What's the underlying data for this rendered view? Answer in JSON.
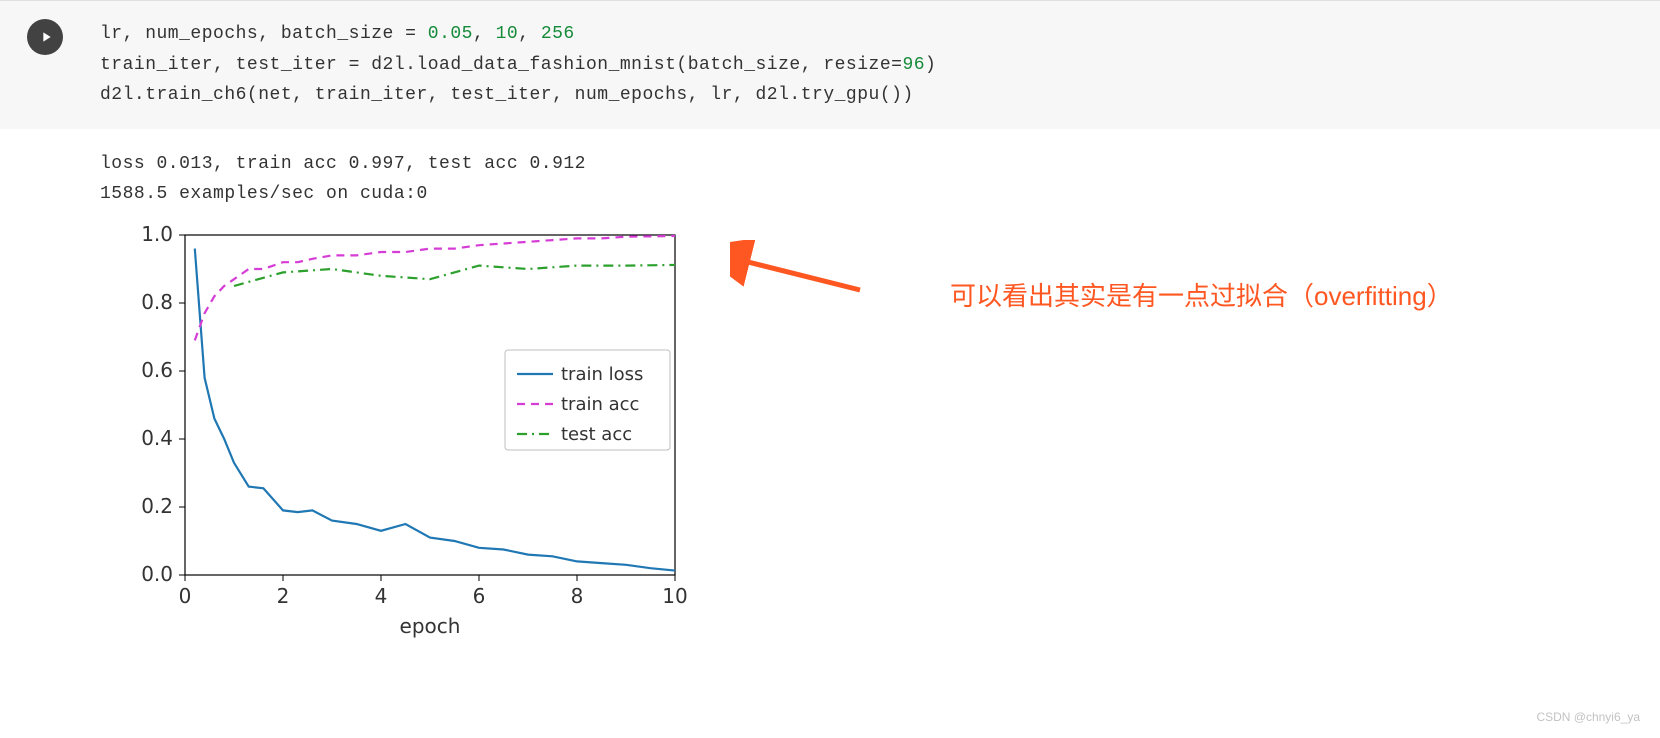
{
  "code": {
    "line1_part1": "lr, num_epochs, batch_size = ",
    "line1_num1": "0.05",
    "line1_sep1": ", ",
    "line1_num2": "10",
    "line1_sep2": ", ",
    "line1_num3": "256",
    "line2_part1": "train_iter, test_iter = d2l.load_data_fashion_mnist(batch_size, resize=",
    "line2_num1": "96",
    "line2_part2": ")",
    "line3": "d2l.train_ch6(net, train_iter, test_iter, num_epochs, lr, d2l.try_gpu())"
  },
  "output": {
    "line1": "loss 0.013, train acc 0.997, test acc 0.912",
    "line2": "1588.5 examples/sec on cuda:0"
  },
  "annotation": {
    "text": "可以看出其实是有一点过拟合（overfitting）"
  },
  "watermark": "CSDN @chnyi6_ya",
  "chart_data": {
    "type": "line",
    "xlabel": "epoch",
    "ylabel": "",
    "xlim": [
      0,
      10
    ],
    "ylim": [
      0.0,
      1.0
    ],
    "xticks": [
      0,
      2,
      4,
      6,
      8,
      10
    ],
    "yticks": [
      0.0,
      0.2,
      0.4,
      0.6,
      0.8,
      1.0
    ],
    "legend": {
      "entries": [
        "train loss",
        "train acc",
        "test acc"
      ],
      "position": "right-inside"
    },
    "series": [
      {
        "name": "train loss",
        "style": "solid",
        "color": "#1f77b4",
        "x": [
          0.2,
          0.4,
          0.6,
          0.8,
          1.0,
          1.3,
          1.6,
          2.0,
          2.3,
          2.6,
          3.0,
          3.5,
          4.0,
          4.5,
          5.0,
          5.5,
          6.0,
          6.5,
          7.0,
          7.5,
          8.0,
          8.5,
          9.0,
          9.5,
          10.0
        ],
        "y": [
          0.96,
          0.58,
          0.46,
          0.4,
          0.33,
          0.26,
          0.255,
          0.19,
          0.185,
          0.19,
          0.16,
          0.15,
          0.13,
          0.15,
          0.11,
          0.1,
          0.08,
          0.075,
          0.06,
          0.055,
          0.04,
          0.035,
          0.03,
          0.02,
          0.013
        ]
      },
      {
        "name": "train acc",
        "style": "dashed",
        "color": "#d63cd6",
        "x": [
          0.2,
          0.4,
          0.6,
          0.8,
          1.0,
          1.3,
          1.6,
          2.0,
          2.3,
          2.6,
          3.0,
          3.5,
          4.0,
          4.5,
          5.0,
          5.5,
          6.0,
          6.5,
          7.0,
          7.5,
          8.0,
          8.5,
          9.0,
          9.5,
          10.0
        ],
        "y": [
          0.69,
          0.77,
          0.82,
          0.85,
          0.87,
          0.9,
          0.9,
          0.92,
          0.92,
          0.93,
          0.94,
          0.94,
          0.95,
          0.95,
          0.96,
          0.96,
          0.97,
          0.975,
          0.98,
          0.985,
          0.99,
          0.99,
          0.995,
          0.996,
          0.997
        ]
      },
      {
        "name": "test acc",
        "style": "dashdot",
        "color": "#2ca02c",
        "x": [
          1,
          2,
          3,
          4,
          5,
          6,
          7,
          8,
          9,
          10
        ],
        "y": [
          0.85,
          0.89,
          0.9,
          0.88,
          0.87,
          0.91,
          0.9,
          0.91,
          0.91,
          0.912
        ]
      }
    ]
  }
}
